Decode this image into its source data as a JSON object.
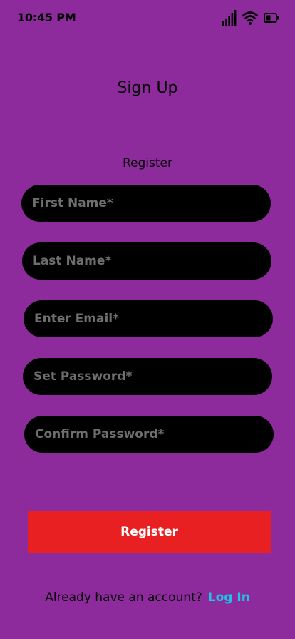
{
  "status_bar": {
    "time": "10:45 PM",
    "icons": [
      "signal-icon",
      "wifi-icon",
      "battery-icon"
    ]
  },
  "header": {
    "title": "Sign Up"
  },
  "form": {
    "subtitle": "Register",
    "fields": [
      {
        "placeholder": "First Name*",
        "value": ""
      },
      {
        "placeholder": "Last Name*",
        "value": ""
      },
      {
        "placeholder": "Enter Email*",
        "value": ""
      },
      {
        "placeholder": "Set Password*",
        "value": ""
      },
      {
        "placeholder": "Confirm Password*",
        "value": ""
      }
    ],
    "submit_label": "Register"
  },
  "footer": {
    "prompt": "Already have an account?",
    "login_label": "Log In"
  },
  "colors": {
    "background": "#8e2b9c",
    "field_bg": "#000000",
    "button_bg": "#e82021",
    "link": "#1dc3e8"
  }
}
